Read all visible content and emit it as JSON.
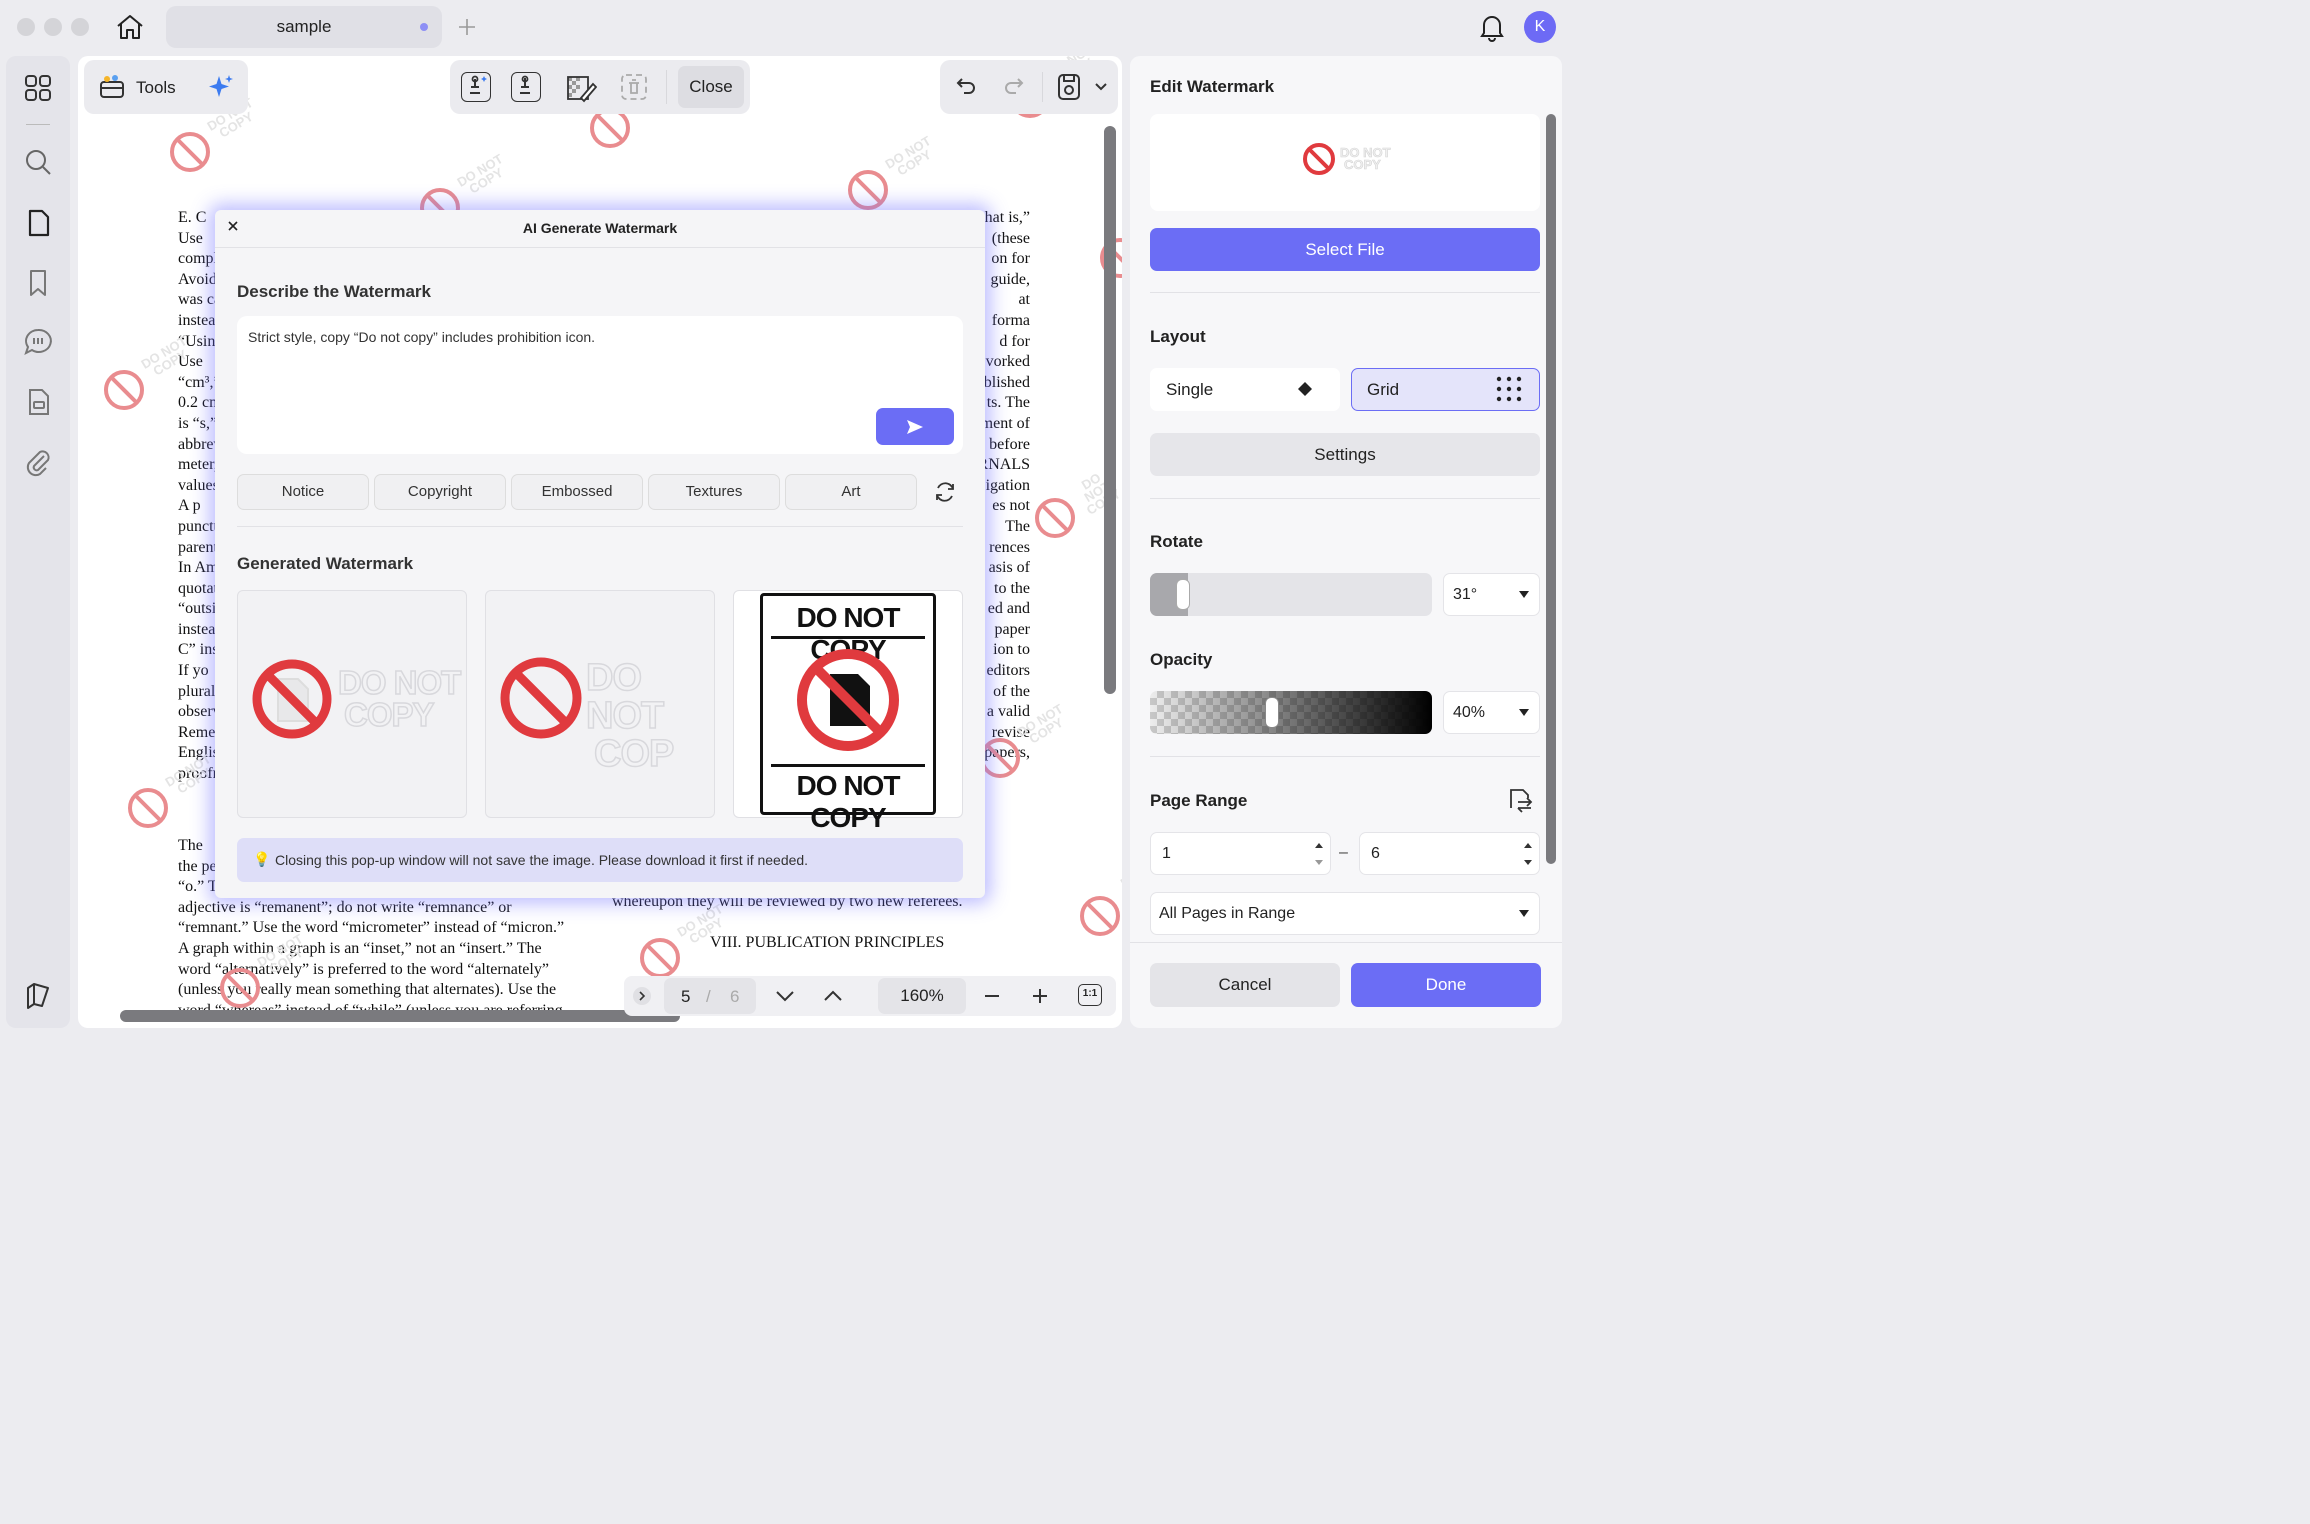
{
  "window": {
    "tab_title": "sample",
    "avatar_letter": "K"
  },
  "toolbar": {
    "tools_label": "Tools",
    "close_label": "Close"
  },
  "document": {
    "left_lines": [
      "E.  C",
      "Use",
      "comple",
      "Avoid",
      "was ca",
      "instead",
      "“Using",
      "Use",
      "“cm³,”",
      "0.2 cm",
      "is  “s,”",
      "abbrev",
      "meter,”",
      "values.",
      "A  p",
      "punctu",
      "parenth",
      "In  Am",
      "quotat",
      "“outsi",
      "instead",
      "C” inst",
      "If yo",
      "plural",
      "observ",
      "Remen",
      "Englis",
      "proofr"
    ],
    "right_lines": [
      "hat is,”",
      "(these",
      "on for",
      "guide,",
      "at",
      "forma",
      "d  for",
      "vorked",
      "blished",
      "ts. The",
      "ment of",
      "before",
      "RNALS",
      "igation",
      "es  not",
      "The",
      "rences",
      "asis of",
      "to the",
      "ed and",
      "paper",
      "ion to",
      "editors",
      "of  the",
      "a valid",
      "revise",
      "papers,"
    ],
    "bottom_left": [
      "The",
      "the per",
      "“o.” Th",
      "adjective  is  “remanent”;  do  not  write  “remnance”  or",
      "“remnant.” Use the word “micrometer” instead of “micron.”",
      "A graph within a graph is an “inset,” not an “insert.” The",
      "word “alternatively” is preferred to the word “alternately”",
      "(unless you really mean something that alternates). Use the",
      "word “whereas” instead of “while” (unless you are referring"
    ],
    "bottom_right": [
      "whereupon they will be reviewed by two new referees.",
      "VIII.   PUBLICATION PRINCIPLES"
    ],
    "watermark_text_line1": "DO NOT",
    "watermark_text_line2": "COPY"
  },
  "dialog": {
    "title": "AI Generate Watermark",
    "describe_heading": "Describe the Watermark",
    "prompt_text": "Strict style, copy “Do not copy” includes prohibition icon.",
    "chips": [
      "Notice",
      "Copyright",
      "Embossed",
      "Textures",
      "Art"
    ],
    "generated_heading": "Generated Watermark",
    "cards": [
      {
        "line1": "DO NOT",
        "line2": "COPY"
      },
      {
        "line1": "DO NOT",
        "line2": "COP"
      },
      {
        "top": "DO NOT COPY",
        "bottom": "DO NOT COPY"
      }
    ],
    "notice": "Closing this pop-up window will not save the image. Please download it first if needed."
  },
  "panel": {
    "title": "Edit Watermark",
    "preview_line1": "DO NOT",
    "preview_line2": "COPY",
    "select_file": "Select File",
    "layout_heading": "Layout",
    "layout_single": "Single",
    "layout_grid": "Grid",
    "settings": "Settings",
    "rotate_heading": "Rotate",
    "rotate_value": "31°",
    "rotate_fraction": 0.086,
    "opacity_heading": "Opacity",
    "opacity_value": "40%",
    "opacity_fraction": 0.4,
    "page_range_heading": "Page Range",
    "range_from": "1",
    "range_dash": "–",
    "range_to": "6",
    "range_mode": "All Pages in Range",
    "cancel": "Cancel",
    "done": "Done"
  },
  "pager": {
    "current": "5",
    "sep": "/",
    "total": "6",
    "zoom": "160%",
    "fit_label": "1:1"
  },
  "colors": {
    "accent": "#6b6df5",
    "prohibit_red": "#e03a3e"
  }
}
